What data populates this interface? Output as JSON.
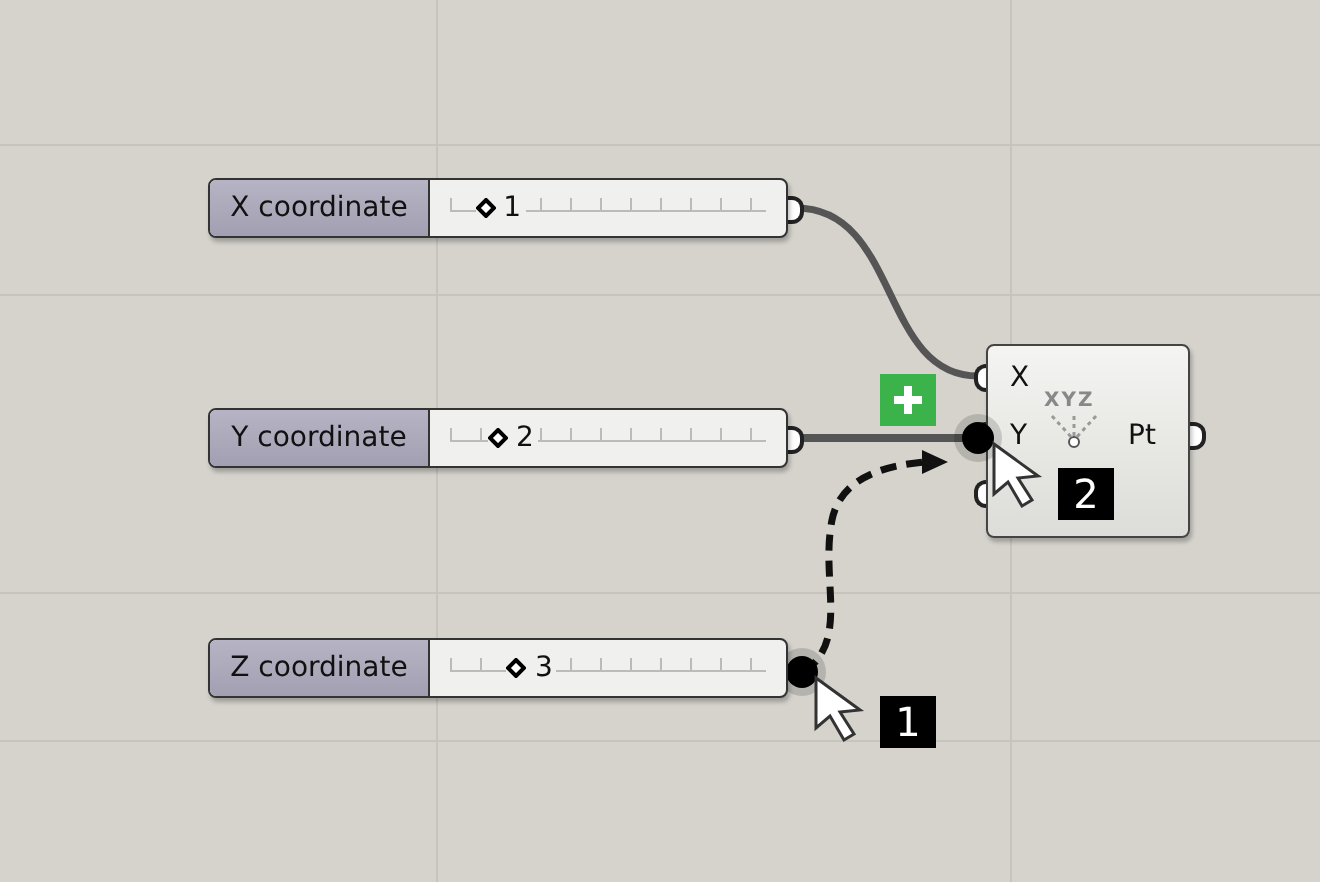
{
  "sliders": [
    {
      "label": "X coordinate",
      "value": "1",
      "level": 0.08,
      "dragging": false
    },
    {
      "label": "Y coordinate",
      "value": "2",
      "level": 0.12,
      "dragging": false
    },
    {
      "label": "Z coordinate",
      "value": "3",
      "level": 0.18,
      "dragging": true
    }
  ],
  "component": {
    "inputs": [
      "X",
      "Y"
    ],
    "icon_text": "XYZ",
    "output": "Pt"
  },
  "steps": [
    "1",
    "2"
  ]
}
